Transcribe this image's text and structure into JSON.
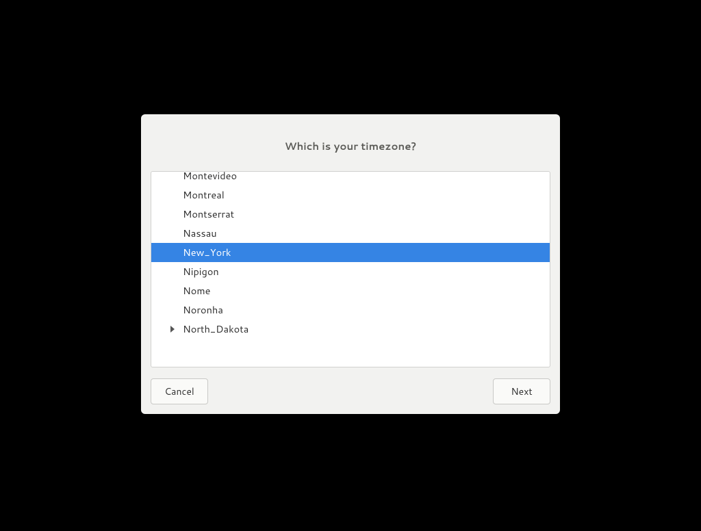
{
  "dialog": {
    "title": "Which is your timezone?",
    "buttons": {
      "cancel": "Cancel",
      "next": "Next"
    }
  },
  "timezone_list": {
    "items": [
      {
        "label": "Montevideo",
        "selected": false,
        "expandable": false
      },
      {
        "label": "Montreal",
        "selected": false,
        "expandable": false
      },
      {
        "label": "Montserrat",
        "selected": false,
        "expandable": false
      },
      {
        "label": "Nassau",
        "selected": false,
        "expandable": false
      },
      {
        "label": "New_York",
        "selected": true,
        "expandable": false
      },
      {
        "label": "Nipigon",
        "selected": false,
        "expandable": false
      },
      {
        "label": "Nome",
        "selected": false,
        "expandable": false
      },
      {
        "label": "Noronha",
        "selected": false,
        "expandable": false
      },
      {
        "label": "North_Dakota",
        "selected": false,
        "expandable": true
      }
    ]
  }
}
